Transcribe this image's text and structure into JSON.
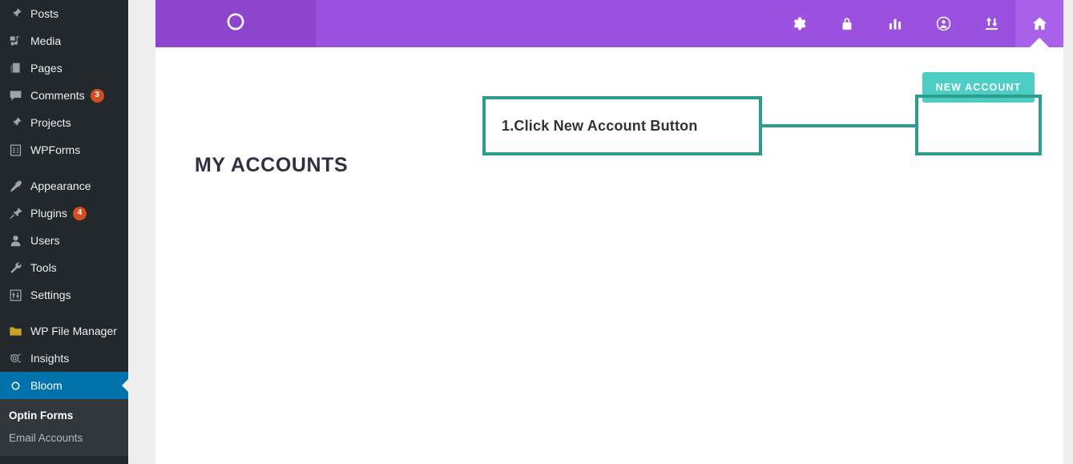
{
  "sidebar": {
    "items": [
      {
        "label": "Posts",
        "icon": "pin-icon",
        "badge": null,
        "active": false
      },
      {
        "label": "Media",
        "icon": "media-icon",
        "badge": null,
        "active": false
      },
      {
        "label": "Pages",
        "icon": "pages-icon",
        "badge": null,
        "active": false
      },
      {
        "label": "Comments",
        "icon": "comment-icon",
        "badge": "3",
        "active": false
      },
      {
        "label": "Projects",
        "icon": "pin-icon",
        "badge": null,
        "active": false
      },
      {
        "label": "WPForms",
        "icon": "forms-icon",
        "badge": null,
        "active": false
      },
      {
        "label": "Appearance",
        "icon": "brush-icon",
        "badge": null,
        "active": false,
        "separator_before": true
      },
      {
        "label": "Plugins",
        "icon": "plug-icon",
        "badge": "4",
        "active": false
      },
      {
        "label": "Users",
        "icon": "user-icon",
        "badge": null,
        "active": false
      },
      {
        "label": "Tools",
        "icon": "wrench-icon",
        "badge": null,
        "active": false
      },
      {
        "label": "Settings",
        "icon": "sliders-icon",
        "badge": null,
        "active": false
      },
      {
        "label": "WP File Manager",
        "icon": "folder-icon",
        "badge": null,
        "active": false,
        "separator_before": true
      },
      {
        "label": "Insights",
        "icon": "insights-icon",
        "badge": null,
        "active": false
      },
      {
        "label": "Bloom",
        "icon": "bloom-logo-icon",
        "badge": null,
        "active": true
      }
    ],
    "submenu": [
      {
        "label": "Optin Forms",
        "current": true
      },
      {
        "label": "Email Accounts",
        "current": false
      }
    ],
    "colors": {
      "background": "#23282d",
      "submenu_background": "#32373c",
      "active_background": "#0073aa",
      "badge_background": "#d54e21",
      "text": "#eeeeee"
    }
  },
  "header": {
    "logo_icon": "bloom-logo-icon",
    "nav_items": [
      {
        "icon": "gear-icon",
        "name": "settings",
        "active": false
      },
      {
        "icon": "lock-icon",
        "name": "privacy",
        "active": false
      },
      {
        "icon": "bar-chart-icon",
        "name": "statistics",
        "active": false
      },
      {
        "icon": "user-circle-icon",
        "name": "account",
        "active": false
      },
      {
        "icon": "import-export-icon",
        "name": "import-export",
        "active": false
      },
      {
        "icon": "home-icon",
        "name": "home",
        "active": true
      }
    ],
    "colors": {
      "bar": "#9b51e0",
      "logo_block": "#8e44cc",
      "active_tab": "#a961ea"
    }
  },
  "main": {
    "page_title": "MY ACCOUNTS",
    "new_account_label": "NEW ACCOUNT",
    "new_account_color": "#4ecdc4"
  },
  "annotation": {
    "callout_text": "1.Click New Account Button",
    "color": "#2a9d8f"
  }
}
